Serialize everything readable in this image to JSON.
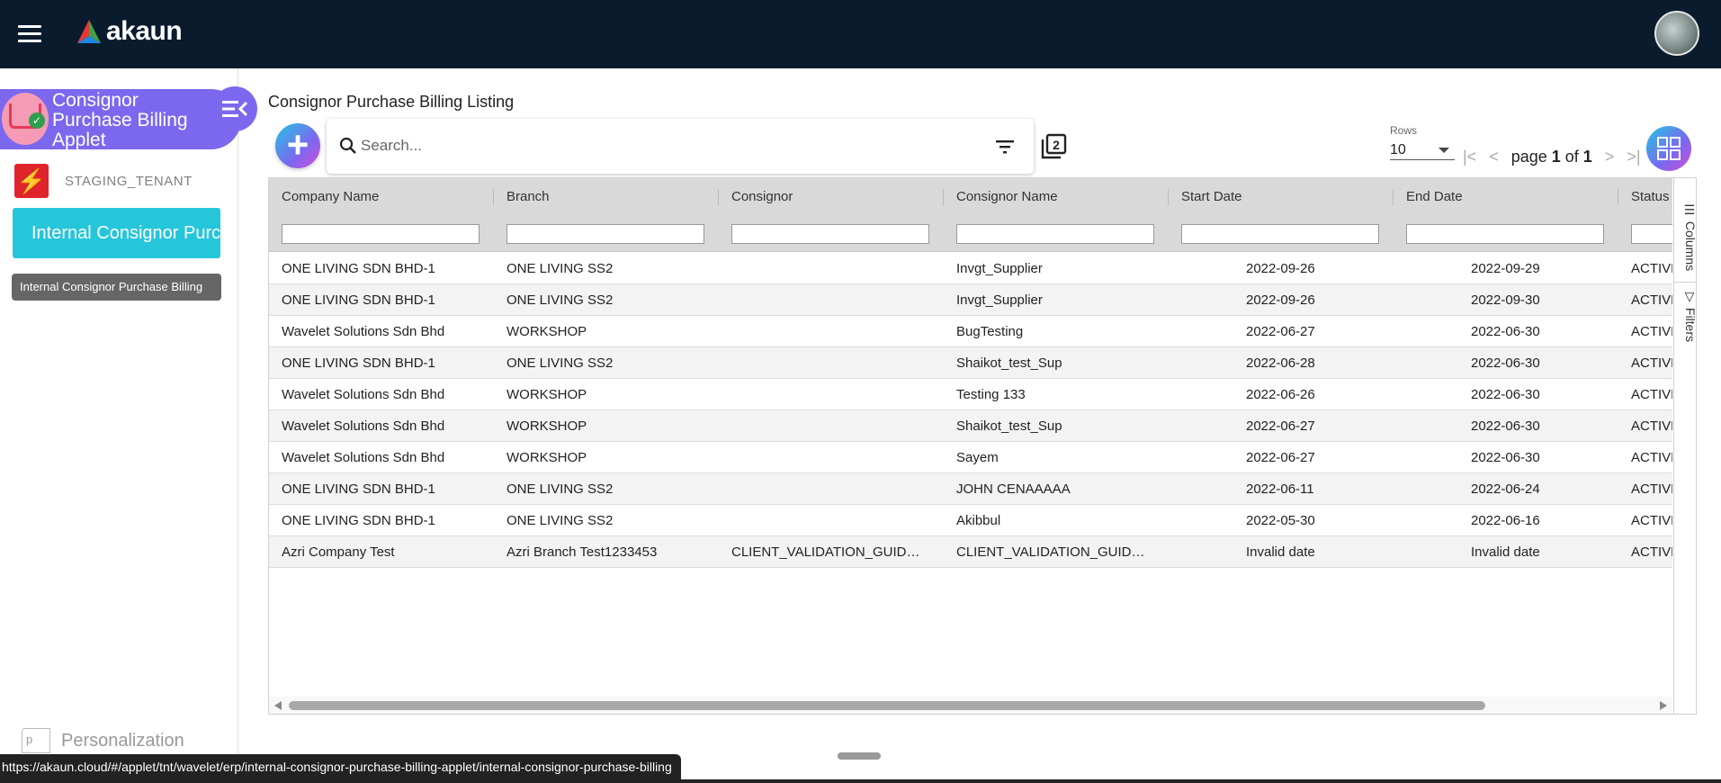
{
  "app": {
    "logo_text": "akaun"
  },
  "sidebar": {
    "applet_title": "Consignor Purchase Billing Applet",
    "tenant_name": "STAGING_TENANT",
    "active_item": "Internal Consignor Purchase Billing",
    "tooltip": "Internal Consignor Purchase Billing",
    "personalization_alt": "p",
    "personalization": "Personalization"
  },
  "main": {
    "title": "Consignor Purchase Billing Listing",
    "search_placeholder": "Search...",
    "rows_label": "Rows",
    "rows_value": "10",
    "page_word": "page",
    "page_current": "1",
    "of_word": "of",
    "page_total": "1"
  },
  "grid": {
    "columns": [
      "Company Name",
      "Branch",
      "Consignor",
      "Consignor Name",
      "Start Date",
      "End Date",
      "Status"
    ],
    "rows": [
      [
        "ONE LIVING SDN BHD-1",
        "ONE LIVING SS2",
        "",
        "Invgt_Supplier",
        "2022-09-26",
        "2022-09-29",
        "ACTIVE"
      ],
      [
        "ONE LIVING SDN BHD-1",
        "ONE LIVING SS2",
        "",
        "Invgt_Supplier",
        "2022-09-26",
        "2022-09-30",
        "ACTIVE"
      ],
      [
        "Wavelet Solutions Sdn Bhd",
        "WORKSHOP",
        "",
        "BugTesting",
        "2022-06-27",
        "2022-06-30",
        "ACTIVE"
      ],
      [
        "ONE LIVING SDN BHD-1",
        "ONE LIVING SS2",
        "",
        "Shaikot_test_Sup",
        "2022-06-28",
        "2022-06-30",
        "ACTIVE"
      ],
      [
        "Wavelet Solutions Sdn Bhd",
        "WORKSHOP",
        "",
        "Testing 133",
        "2022-06-26",
        "2022-06-30",
        "ACTIVE"
      ],
      [
        "Wavelet Solutions Sdn Bhd",
        "WORKSHOP",
        "",
        "Shaikot_test_Sup",
        "2022-06-27",
        "2022-06-30",
        "ACTIVE"
      ],
      [
        "Wavelet Solutions Sdn Bhd",
        "WORKSHOP",
        "",
        "Sayem",
        "2022-06-27",
        "2022-06-30",
        "ACTIVE"
      ],
      [
        "ONE LIVING SDN BHD-1",
        "ONE LIVING SS2",
        "",
        "JOHN CENAAAAA",
        "2022-06-11",
        "2022-06-24",
        "ACTIVE"
      ],
      [
        "ONE LIVING SDN BHD-1",
        "ONE LIVING SS2",
        "",
        "Akibbul",
        "2022-05-30",
        "2022-06-16",
        "ACTIVE"
      ],
      [
        "Azri Company Test",
        "Azri Branch Test1233453",
        "CLIENT_VALIDATION_GUID_DO...",
        "CLIENT_VALIDATION_GUID_DO...",
        "Invalid date",
        "Invalid date",
        "ACTIVE"
      ]
    ],
    "side_tabs": [
      "Columns",
      "Filters"
    ]
  },
  "status_url": "https://akaun.cloud/#/applet/tnt/wavelet/erp/internal-consignor-purchase-billing-applet/internal-consignor-purchase-billing"
}
